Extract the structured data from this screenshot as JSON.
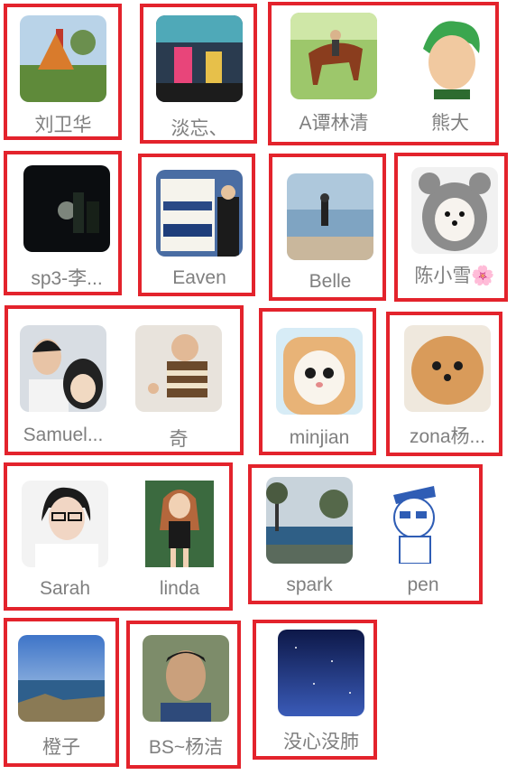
{
  "contacts": [
    {
      "name": "刘卫华",
      "icon": "avatar-playground"
    },
    {
      "name": "淡忘、",
      "icon": "avatar-poster"
    },
    {
      "name": "A谭林清",
      "icon": "avatar-horse-rider"
    },
    {
      "name": "熊大",
      "icon": "avatar-anime-green-hair"
    },
    {
      "name": "sp3-李...",
      "icon": "avatar-night-city"
    },
    {
      "name": "Eaven",
      "icon": "avatar-market-sign"
    },
    {
      "name": "Belle",
      "icon": "avatar-beach"
    },
    {
      "name": "陈小雪🌸",
      "icon": "avatar-dog-costume"
    },
    {
      "name": "Samuel...",
      "icon": "avatar-man-with-doll"
    },
    {
      "name": "奇",
      "icon": "avatar-baby"
    },
    {
      "name": "minjian",
      "icon": "avatar-cat-bread"
    },
    {
      "name": "zona杨...",
      "icon": "avatar-pomeranian"
    },
    {
      "name": "Sarah",
      "icon": "avatar-girl-glasses"
    },
    {
      "name": "linda",
      "icon": "avatar-woman"
    },
    {
      "name": "spark",
      "icon": "avatar-pool-landscape"
    },
    {
      "name": "pen",
      "icon": "avatar-cartoon-boy"
    },
    {
      "name": "橙子",
      "icon": "avatar-seaside"
    },
    {
      "name": "BS~杨洁",
      "icon": "avatar-man-portrait"
    },
    {
      "name": "没心没肺",
      "icon": "avatar-starry-sky"
    }
  ],
  "colors": {
    "highlight": "#e3232c",
    "label": "#7f7f7f"
  }
}
